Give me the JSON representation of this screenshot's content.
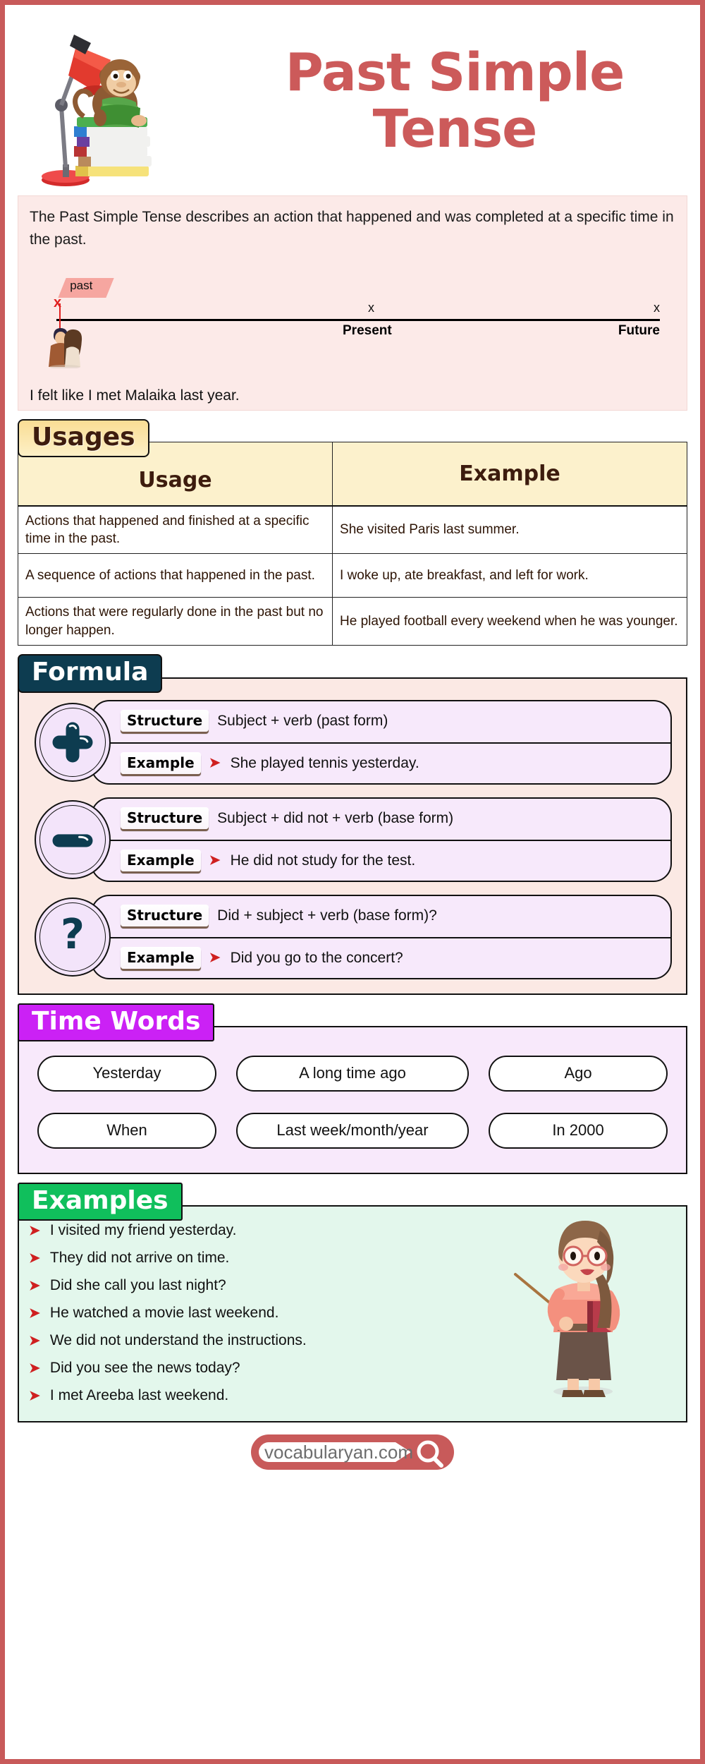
{
  "theme": {
    "border_color": "#c85a5a",
    "title_color": "#cc5a5a",
    "usages_tab_color": "#f9dd94",
    "formula_tab_color": "#0d3c50",
    "timewords_tab_color": "#cb21f5",
    "examples_tab_color": "#10bf5c",
    "arrow_bullet_color": "#cf2020"
  },
  "header": {
    "title_line1": "Past Simple",
    "title_line2": "Tense",
    "illustration_left": "monkey-reading-on-books-with-desk-lamp"
  },
  "definition": {
    "text": "The Past Simple Tense describes an action that happened and was completed at a specific time in the past.",
    "example_sentence": "I felt like I met Malaika last year.",
    "timeline": {
      "past_label": "past",
      "past_marker": "x",
      "present_marker": "x",
      "present_label": "Present",
      "future_marker": "x",
      "future_label": "Future",
      "illustration": "couple-embracing"
    }
  },
  "usages": {
    "tab_label": "Usages",
    "columns": [
      "Usage",
      "Example"
    ],
    "rows": [
      {
        "usage": "Actions that happened and finished at a specific time in the past.",
        "example": "She visited Paris last summer."
      },
      {
        "usage": "A sequence of actions that happened in the past.",
        "example": "I woke up, ate breakfast, and left for work."
      },
      {
        "usage": "Actions that were regularly done in the past but no longer happen.",
        "example": "He played football every weekend when he was younger."
      }
    ]
  },
  "formula": {
    "tab_label": "Formula",
    "structure_label": "Structure",
    "example_label": "Example",
    "rows": [
      {
        "symbol": "plus-icon",
        "structure": "Subject + verb (past form)",
        "example": "She played tennis yesterday."
      },
      {
        "symbol": "minus-icon",
        "structure": "Subject + did not + verb (base form)",
        "example": "He did not study for the test."
      },
      {
        "symbol": "question-mark-icon",
        "structure": "Did + subject + verb (base form)?",
        "example": "Did you go to the concert?"
      }
    ]
  },
  "time_words": {
    "tab_label": "Time Words",
    "items": [
      "Yesterday",
      "A long time ago",
      "Ago",
      "When",
      "Last week/month/year",
      "In 2000"
    ]
  },
  "examples": {
    "tab_label": "Examples",
    "items": [
      "I visited my friend yesterday.",
      "They did not arrive on time.",
      "Did she call you last night?",
      "He watched a movie last weekend.",
      "We did not understand the instructions.",
      "Did you see the news today?",
      "I met Areeba last weekend."
    ],
    "illustration": "teacher-with-pointer-stick"
  },
  "footer": {
    "site_name": "vocabularyan.com",
    "icon": "magnifier-icon"
  }
}
